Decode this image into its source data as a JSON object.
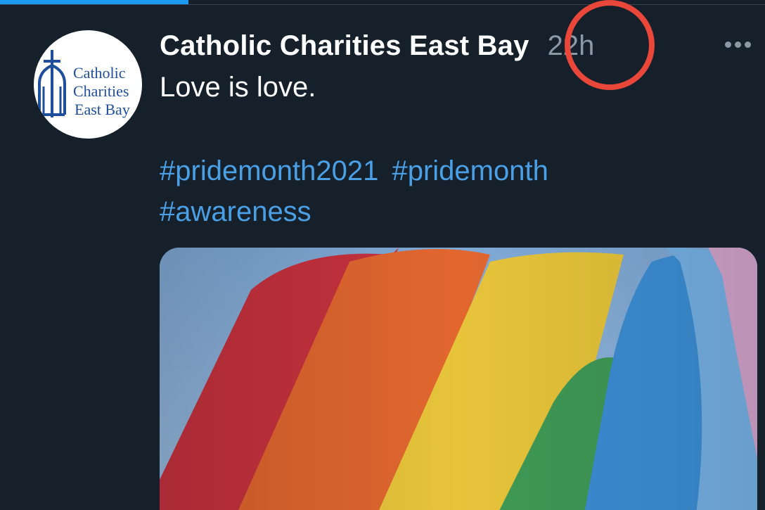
{
  "tweet": {
    "author_name": "Catholic Charities East Bay",
    "timestamp": "22h",
    "text": "Love is love.",
    "hashtags": [
      "#pridemonth2021",
      "#pridemonth",
      "#awareness"
    ],
    "media_subject": "rainbow pride flag"
  },
  "avatar": {
    "logo_lines": [
      "Catholic",
      "Charities",
      "East Bay"
    ]
  },
  "colors": {
    "background": "#15202b",
    "hashtag": "#4a9fe5",
    "timestamp": "#8b98a5",
    "annotation_circle": "#e8473a",
    "accent": "#1d9bf0"
  },
  "icons": {
    "more": "more-horizontal-icon",
    "avatar_logo": "cross-church-logo"
  }
}
